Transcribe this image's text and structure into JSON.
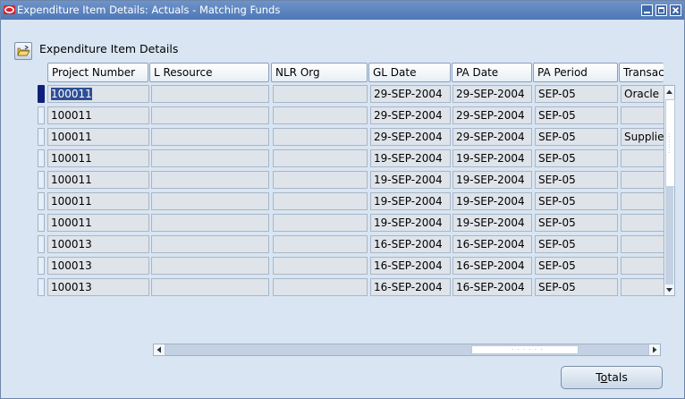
{
  "window": {
    "title": "Expenditure Item Details: Actuals - Matching Funds"
  },
  "panel": {
    "title": "Expenditure Item Details",
    "icon": "open-folder-icon"
  },
  "columns": [
    "Project Number",
    "L Resource",
    "NLR Org",
    "GL Date",
    "PA Date",
    "PA Period",
    "Transac"
  ],
  "rows": [
    {
      "project_number": "100011",
      "l_resource": "",
      "nlr_org": "",
      "gl_date": "29-SEP-2004",
      "pa_date": "29-SEP-2004",
      "pa_period": "SEP-05",
      "transaction": "Oracle"
    },
    {
      "project_number": "100011",
      "l_resource": "",
      "nlr_org": "",
      "gl_date": "29-SEP-2004",
      "pa_date": "29-SEP-2004",
      "pa_period": "SEP-05",
      "transaction": ""
    },
    {
      "project_number": "100011",
      "l_resource": "",
      "nlr_org": "",
      "gl_date": "29-SEP-2004",
      "pa_date": "29-SEP-2004",
      "pa_period": "SEP-05",
      "transaction": "Supplie"
    },
    {
      "project_number": "100011",
      "l_resource": "",
      "nlr_org": "",
      "gl_date": "19-SEP-2004",
      "pa_date": "19-SEP-2004",
      "pa_period": "SEP-05",
      "transaction": ""
    },
    {
      "project_number": "100011",
      "l_resource": "",
      "nlr_org": "",
      "gl_date": "19-SEP-2004",
      "pa_date": "19-SEP-2004",
      "pa_period": "SEP-05",
      "transaction": ""
    },
    {
      "project_number": "100011",
      "l_resource": "",
      "nlr_org": "",
      "gl_date": "19-SEP-2004",
      "pa_date": "19-SEP-2004",
      "pa_period": "SEP-05",
      "transaction": ""
    },
    {
      "project_number": "100011",
      "l_resource": "",
      "nlr_org": "",
      "gl_date": "19-SEP-2004",
      "pa_date": "19-SEP-2004",
      "pa_period": "SEP-05",
      "transaction": ""
    },
    {
      "project_number": "100013",
      "l_resource": "",
      "nlr_org": "",
      "gl_date": "16-SEP-2004",
      "pa_date": "16-SEP-2004",
      "pa_period": "SEP-05",
      "transaction": ""
    },
    {
      "project_number": "100013",
      "l_resource": "",
      "nlr_org": "",
      "gl_date": "16-SEP-2004",
      "pa_date": "16-SEP-2004",
      "pa_period": "SEP-05",
      "transaction": ""
    },
    {
      "project_number": "100013",
      "l_resource": "",
      "nlr_org": "",
      "gl_date": "16-SEP-2004",
      "pa_date": "16-SEP-2004",
      "pa_period": "SEP-05",
      "transaction": ""
    }
  ],
  "buttons": {
    "totals_prefix": "T",
    "totals_mnemonic": "o",
    "totals_suffix": "tals"
  },
  "colors": {
    "titlebar": "#4d78b8",
    "selected_cell": "#2d4f95",
    "current_row_marker": "#10207a",
    "background": "#d9e5f2"
  }
}
